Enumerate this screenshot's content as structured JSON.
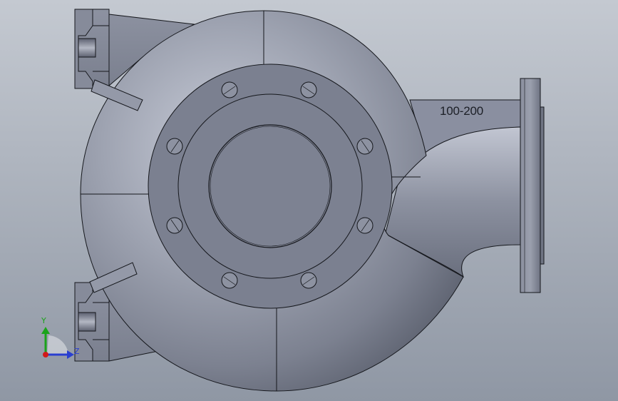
{
  "viewport": {
    "background_top": "#c3c8d0",
    "background_bottom": "#8e96a3"
  },
  "model": {
    "part_label": "100-200",
    "body_color": "#7e8393",
    "edge_color": "#15171c"
  },
  "triad": {
    "y_label": "Y",
    "z_label": "Z",
    "y_color": "#1aa31a",
    "z_color": "#2a3fd0",
    "x_color": "#d11a1a"
  }
}
